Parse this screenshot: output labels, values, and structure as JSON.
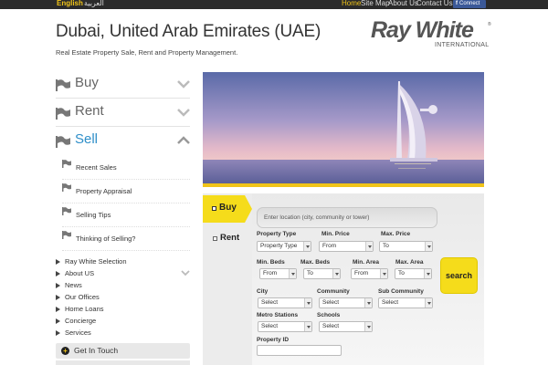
{
  "topbar": {
    "lang_en": "English",
    "lang_ar": "العربية",
    "links": [
      "Home",
      "Site Map",
      "About Us",
      "Contact Us"
    ],
    "facebook": {
      "glyph": "f",
      "label": "Connect"
    }
  },
  "header": {
    "title": "Dubai, United Arab Emirates (UAE)",
    "tagline": "Real Estate Property Sale, Rent and Property Management.",
    "logo_main": "Ray White",
    "logo_reg": "®",
    "logo_sub": "INTERNATIONAL"
  },
  "nav": {
    "main": [
      {
        "label": "Buy",
        "expanded": false
      },
      {
        "label": "Rent",
        "expanded": false
      },
      {
        "label": "Sell",
        "expanded": true
      }
    ],
    "sell_sub": [
      "Recent Sales",
      "Property Appraisal",
      "Selling Tips",
      "Thinking of Selling?"
    ],
    "secondary": [
      "Ray White Selection",
      "About US",
      "News",
      "Our Offices",
      "Home Loans",
      "Concierge",
      "Services"
    ],
    "get_in_touch": "Get In Touch"
  },
  "search": {
    "tabs": {
      "buy": "Buy",
      "rent": "Rent"
    },
    "location_placeholder": "Enter location (city, community or tower)",
    "labels": {
      "property_type": "Property Type",
      "min_price": "Min. Price",
      "max_price": "Max. Price",
      "min_beds": "Min. Beds",
      "max_beds": "Max. Beds",
      "min_area": "Min. Area",
      "max_area": "Max. Area",
      "city": "City",
      "community": "Community",
      "sub_community": "Sub Community",
      "metro": "Metro Stations",
      "schools": "Schools",
      "property_id": "Property ID"
    },
    "values": {
      "property_type": "Property Type",
      "min_price": "From",
      "max_price": "To",
      "min_beds": "From",
      "max_beds": "To",
      "min_area": "From",
      "max_area": "To",
      "city": "Select",
      "community": "Select",
      "sub_community": "Select",
      "metro": "Select",
      "schools": "Select"
    },
    "button": "search"
  },
  "colors": {
    "accent": "#f5dc1b",
    "active_link": "#2f8fc9",
    "topbar": "#2b2b2b"
  }
}
